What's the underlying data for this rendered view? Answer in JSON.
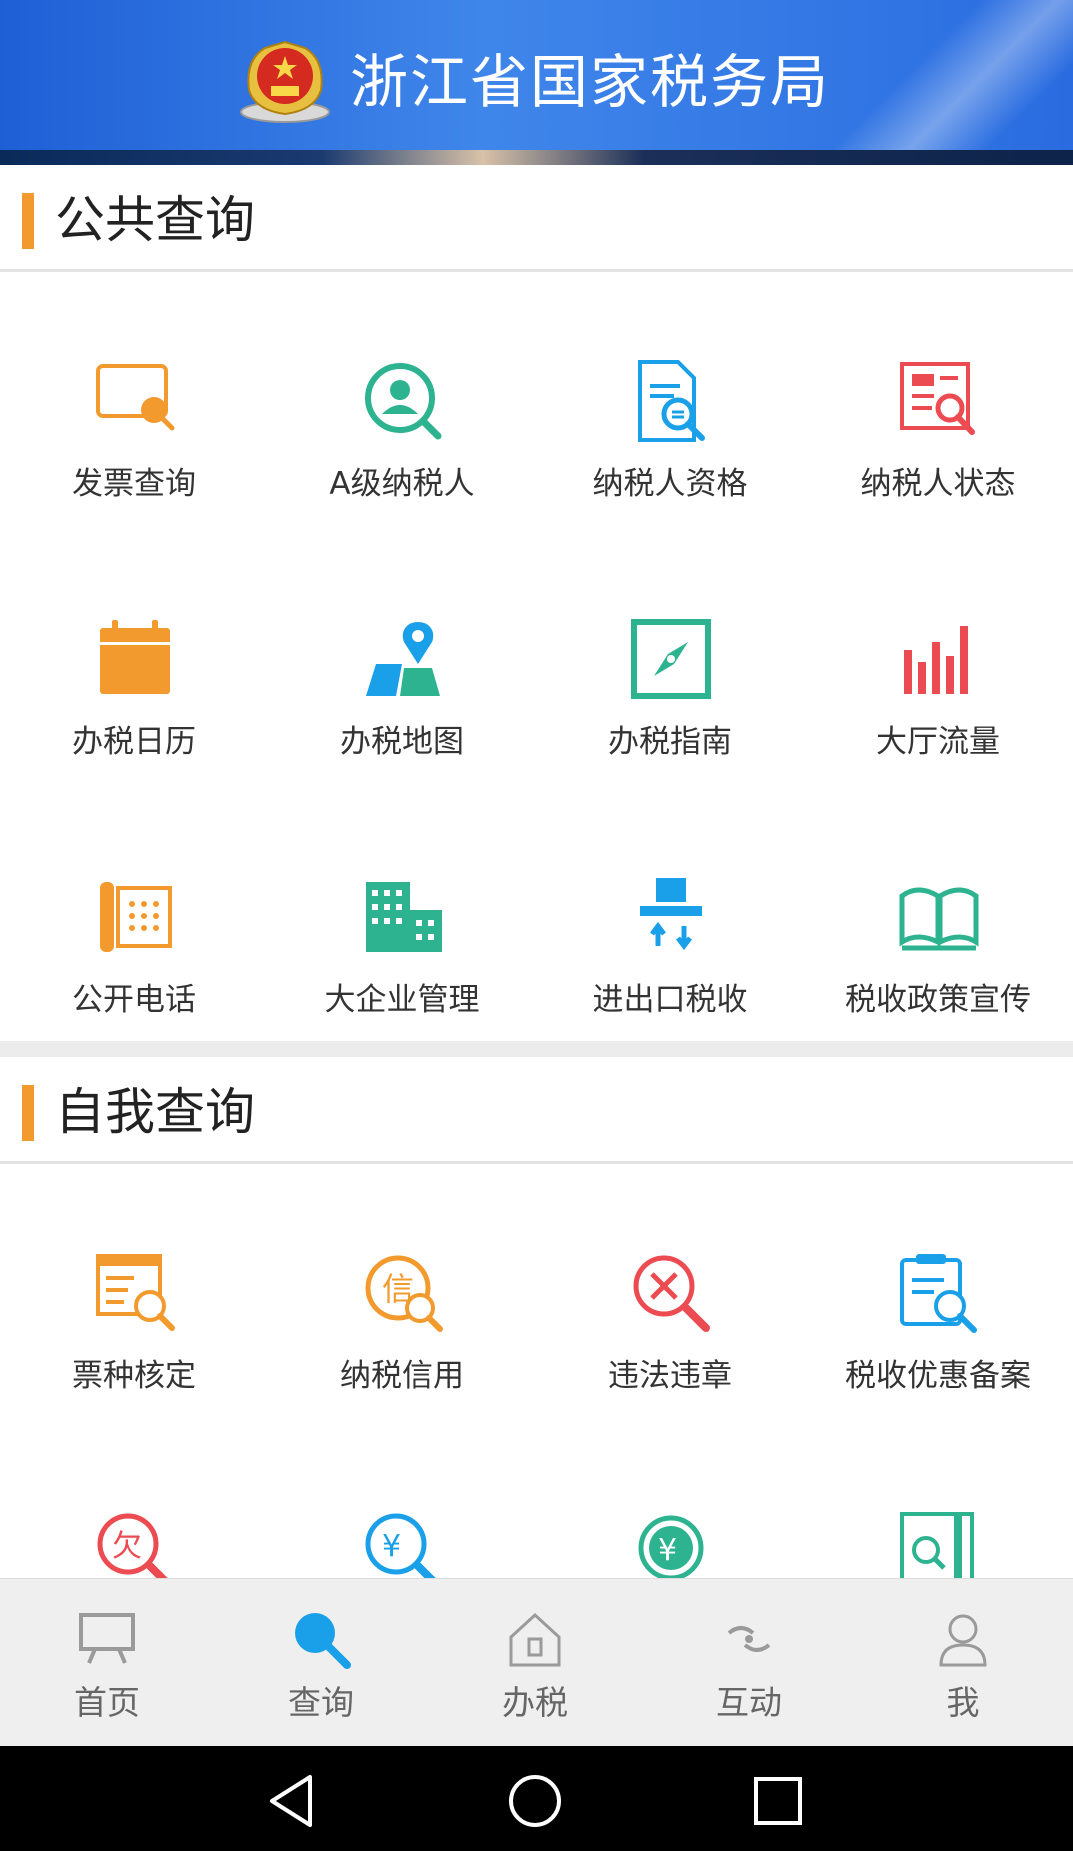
{
  "header": {
    "title": "浙江省国家税务局"
  },
  "public_section": {
    "title": "公共查询",
    "items": [
      {
        "label": "发票查询"
      },
      {
        "label": "A级纳税人"
      },
      {
        "label": "纳税人资格"
      },
      {
        "label": "纳税人状态"
      },
      {
        "label": "办税日历"
      },
      {
        "label": "办税地图"
      },
      {
        "label": "办税指南"
      },
      {
        "label": "大厅流量"
      },
      {
        "label": "公开电话"
      },
      {
        "label": "大企业管理"
      },
      {
        "label": "进出口税收"
      },
      {
        "label": "税收政策宣传"
      }
    ]
  },
  "self_section": {
    "title": "自我查询",
    "items": [
      {
        "label": "票种核定"
      },
      {
        "label": "纳税信用"
      },
      {
        "label": "违法违章"
      },
      {
        "label": "税收优惠备案"
      }
    ]
  },
  "tabs": [
    {
      "label": "首页"
    },
    {
      "label": "查询"
    },
    {
      "label": "办税"
    },
    {
      "label": "互动"
    },
    {
      "label": "我"
    }
  ],
  "active_tab": "查询",
  "colors": {
    "orange": "#f29a2e",
    "teal": "#2db390",
    "blue": "#1aa0e8",
    "red": "#ec4b52",
    "header_blue": "#2a6ce0",
    "active_tab": "#1aa0e8"
  }
}
